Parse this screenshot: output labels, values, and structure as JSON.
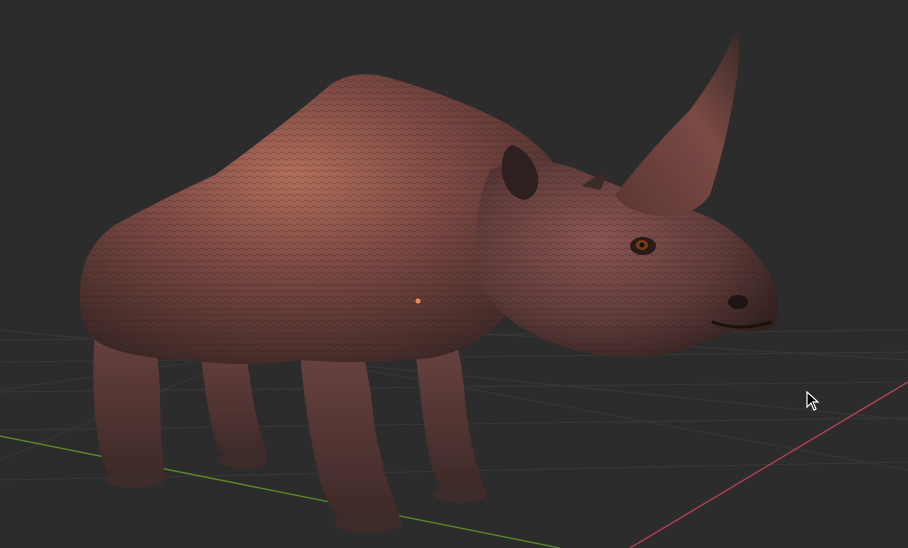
{
  "viewport": {
    "background_color": "#2c2c2c",
    "grid_color": "#3a3a3a",
    "x_axis_color": "#b0414f",
    "y_axis_color": "#5a8a2a",
    "origin_color": "#ff8a4a"
  },
  "object": {
    "icon": "rhinoceros-model",
    "skin_color": "#7a4a45",
    "highlight_color": "#c07a5c",
    "shadow_color": "#3a2624"
  },
  "cursor": {
    "icon": "arrow-cursor-icon"
  }
}
